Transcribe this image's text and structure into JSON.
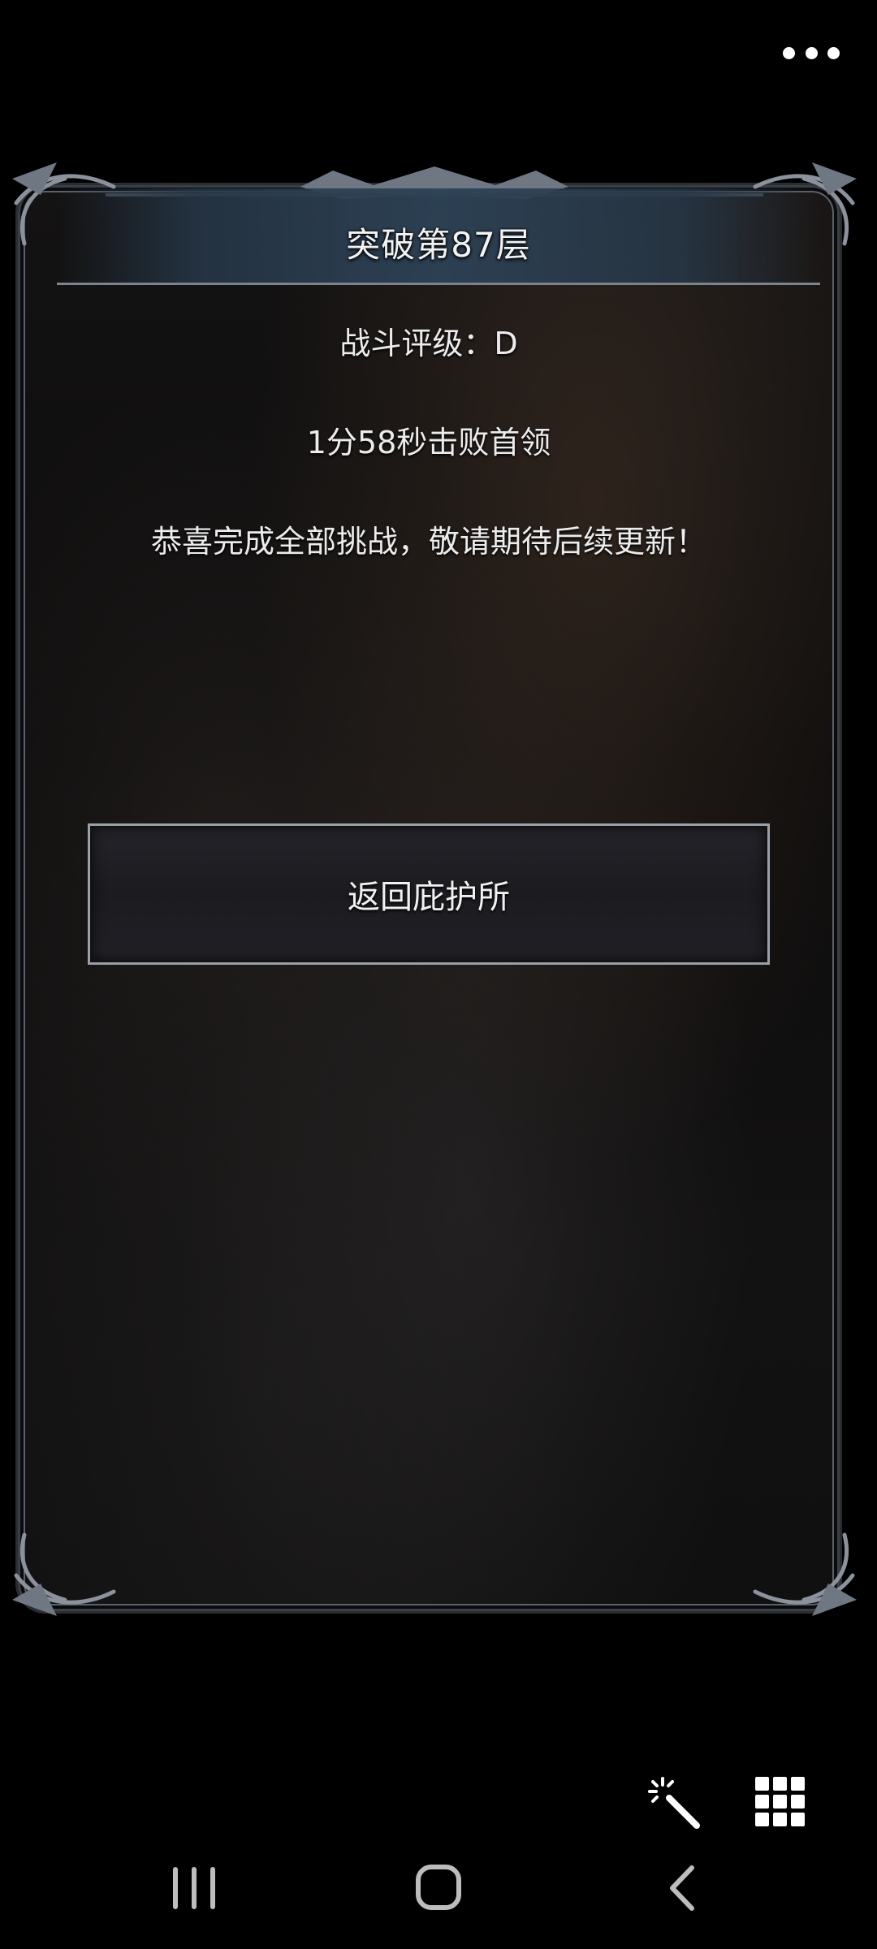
{
  "header": {
    "more_icon": "more-horizontal-icon"
  },
  "panel": {
    "title": "突破第87层",
    "rating_text": "战斗评级：D",
    "time_text": "1分58秒击败首领",
    "congrats_text": "恭喜完成全部挑战，敬请期待后续更新！",
    "return_button_label": "返回庇护所"
  },
  "tools": {
    "magic_icon": "magic-wand-icon",
    "grid_icon": "grid-menu-icon"
  },
  "navbar": {
    "recent_icon": "recent-apps-icon",
    "home_icon": "home-icon",
    "back_icon": "back-icon"
  },
  "colors": {
    "background": "#000000",
    "panel_border": "#5a616b",
    "banner": "#2d4256",
    "text": "#ececec"
  }
}
